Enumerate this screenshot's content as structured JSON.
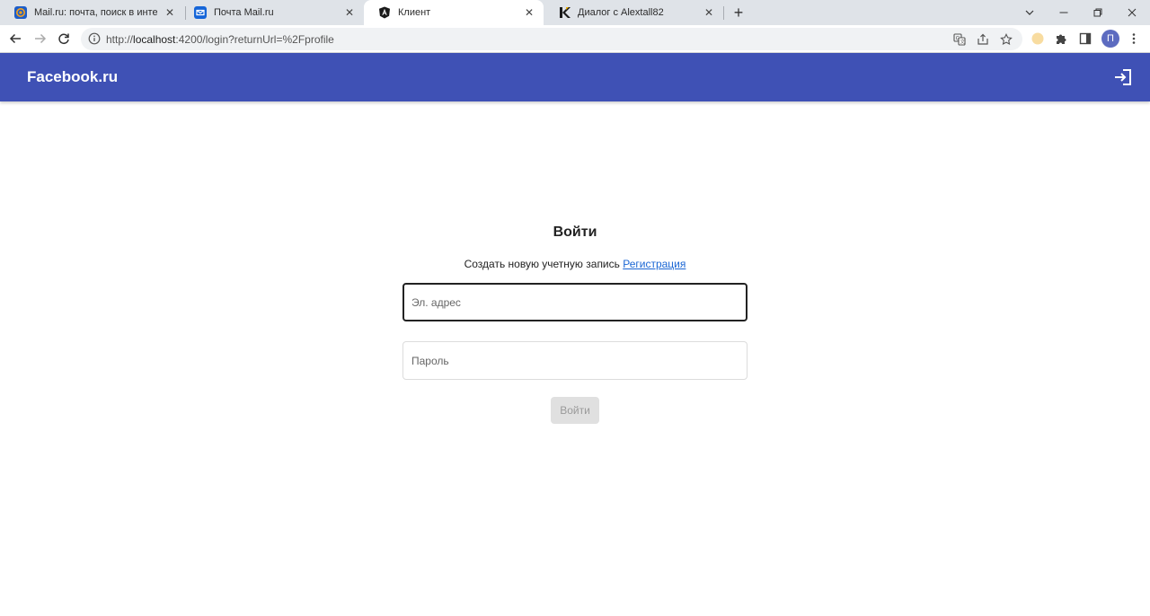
{
  "browser": {
    "tabs": [
      {
        "title": "Mail.ru: почта, поиск в интернете",
        "favicon": "mailru-icon"
      },
      {
        "title": "Почта Mail.ru",
        "favicon": "mail-envelope-icon"
      },
      {
        "title": "Клиент",
        "favicon": "angular-icon",
        "active": true
      },
      {
        "title": "Диалог с Alextall82",
        "favicon": "k-logo-icon"
      }
    ],
    "address": {
      "prefix": "http://",
      "host": "localhost",
      "path": ":4200/login?returnUrl=%2Fprofile"
    },
    "profile_initial": "П"
  },
  "app": {
    "brand": "Facebook.ru",
    "header_color": "#3f51b5"
  },
  "login": {
    "title": "Войти",
    "subtitle": "Создать новую учетную запись",
    "register_link": "Регистрация",
    "email_placeholder": "Эл. адрес",
    "password_placeholder": "Пароль",
    "submit_label": "Войти"
  }
}
